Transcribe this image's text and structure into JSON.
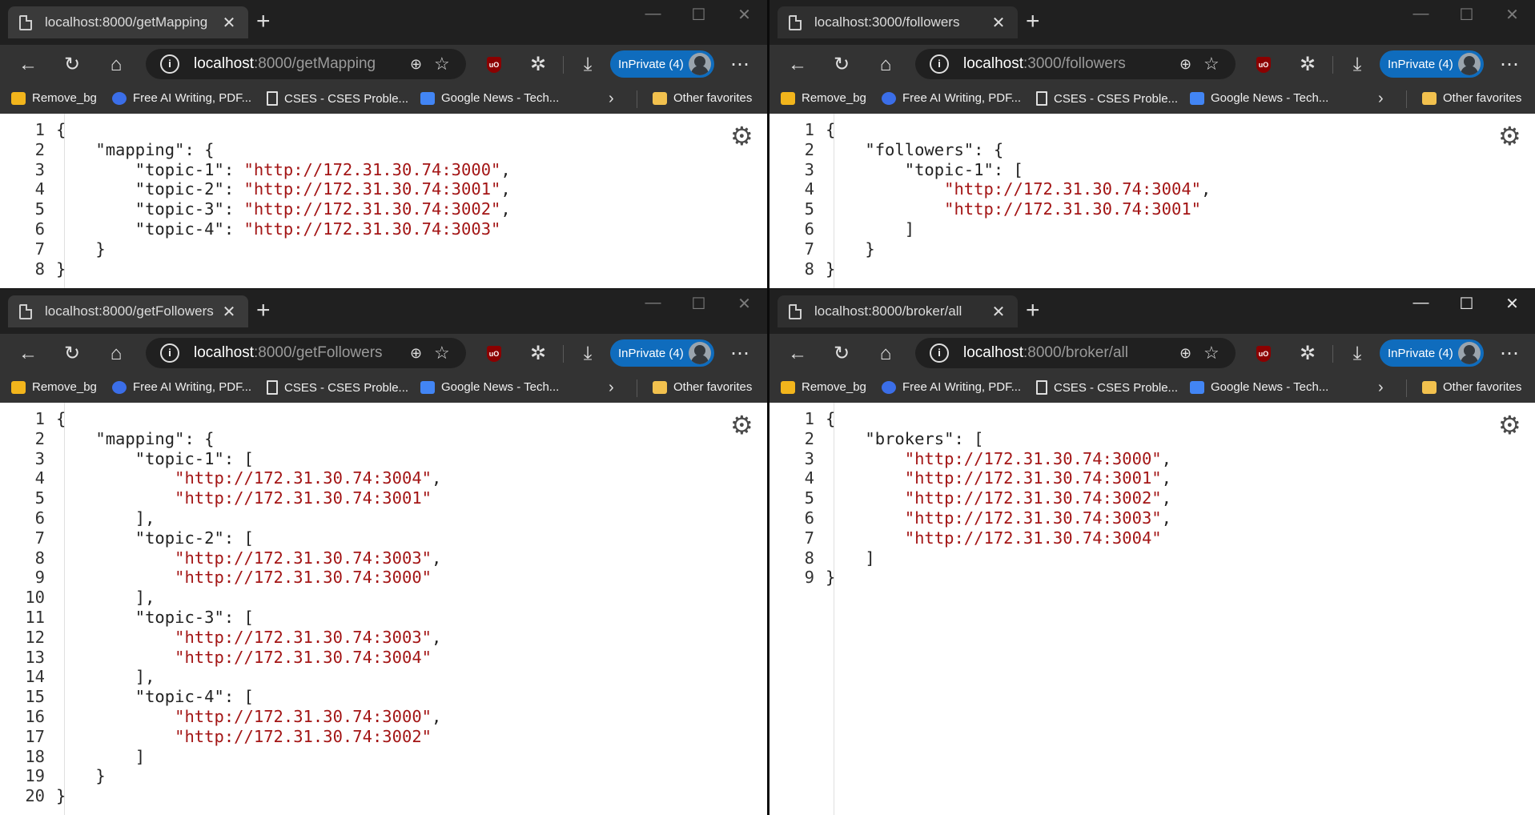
{
  "bookmarks": {
    "items": [
      {
        "label": "Remove_bg",
        "icon": "remove-bg-icon"
      },
      {
        "label": "Free AI Writing, PDF...",
        "icon": "ai-writing-icon"
      },
      {
        "label": "CSES - CSES Proble...",
        "icon": "document-icon"
      },
      {
        "label": "Google News - Tech...",
        "icon": "google-news-icon"
      }
    ],
    "other": "Other favorites"
  },
  "profile_label": "InPrivate (4)",
  "windows": [
    {
      "tab_title": "localhost:8000/getMapping",
      "url_host": "localhost",
      "url_rest": ":8000/getMapping",
      "json_lines": [
        "{",
        "    \"mapping\": {",
        "        \"topic-1\": \"http://172.31.30.74:3000\",",
        "        \"topic-2\": \"http://172.31.30.74:3001\",",
        "        \"topic-3\": \"http://172.31.30.74:3002\",",
        "        \"topic-4\": \"http://172.31.30.74:3003\"",
        "    }",
        "}"
      ]
    },
    {
      "tab_title": "localhost:3000/followers",
      "url_host": "localhost",
      "url_rest": ":3000/followers",
      "json_lines": [
        "{",
        "    \"followers\": {",
        "        \"topic-1\": [",
        "            \"http://172.31.30.74:3004\",",
        "            \"http://172.31.30.74:3001\"",
        "        ]",
        "    }",
        "}"
      ]
    },
    {
      "tab_title": "localhost:8000/getFollowers",
      "url_host": "localhost",
      "url_rest": ":8000/getFollowers",
      "json_lines": [
        "{",
        "    \"mapping\": {",
        "        \"topic-1\": [",
        "            \"http://172.31.30.74:3004\",",
        "            \"http://172.31.30.74:3001\"",
        "        ],",
        "        \"topic-2\": [",
        "            \"http://172.31.30.74:3003\",",
        "            \"http://172.31.30.74:3000\"",
        "        ],",
        "        \"topic-3\": [",
        "            \"http://172.31.30.74:3003\",",
        "            \"http://172.31.30.74:3004\"",
        "        ],",
        "        \"topic-4\": [",
        "            \"http://172.31.30.74:3000\",",
        "            \"http://172.31.30.74:3002\"",
        "        ]",
        "    }",
        "}"
      ]
    },
    {
      "tab_title": "localhost:8000/broker/all",
      "url_host": "localhost",
      "url_rest": ":8000/broker/all",
      "json_lines": [
        "{",
        "    \"brokers\": [",
        "        \"http://172.31.30.74:3000\",",
        "        \"http://172.31.30.74:3001\",",
        "        \"http://172.31.30.74:3002\",",
        "        \"http://172.31.30.74:3003\",",
        "        \"http://172.31.30.74:3004\"",
        "    ]",
        "}"
      ]
    }
  ],
  "colors": {
    "string": "#a31515",
    "accent": "#0f6cbd",
    "chrome": "#333333",
    "tabbar": "#202020"
  }
}
